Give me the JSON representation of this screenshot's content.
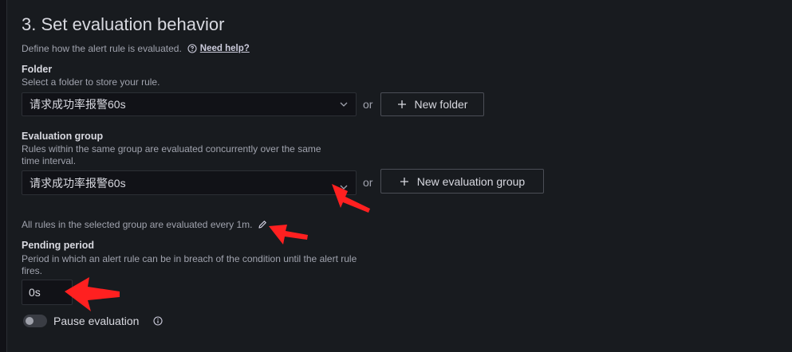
{
  "section": {
    "title": "3. Set evaluation behavior",
    "description": "Define how the alert rule is evaluated.",
    "help_link": "Need help?"
  },
  "folder": {
    "label": "Folder",
    "description": "Select a folder to store your rule.",
    "selected": "请求成功率报警60s",
    "or": "or",
    "new_button": "New folder"
  },
  "evaluation_group": {
    "label": "Evaluation group",
    "description_line1": "Rules within the same group are evaluated concurrently over the same",
    "description_line2": "time interval.",
    "selected": "请求成功率报警60s",
    "or": "or",
    "new_button": "New evaluation group",
    "interval_text": "All rules in the selected group are evaluated every 1m."
  },
  "pending_period": {
    "label": "Pending period",
    "description_line1": "Period in which an alert rule can be in breach of the condition until the alert rule",
    "description_line2": "fires.",
    "value": "0s"
  },
  "pause": {
    "label": "Pause evaluation",
    "enabled": false
  },
  "colors": {
    "background": "#181b1f",
    "input_background": "#111217",
    "annotation_arrow": "#ff2020"
  },
  "icons": [
    "question-circle-icon",
    "chevron-down-icon",
    "plus-icon",
    "pencil-icon",
    "info-circle-icon",
    "annotation-arrow"
  ]
}
